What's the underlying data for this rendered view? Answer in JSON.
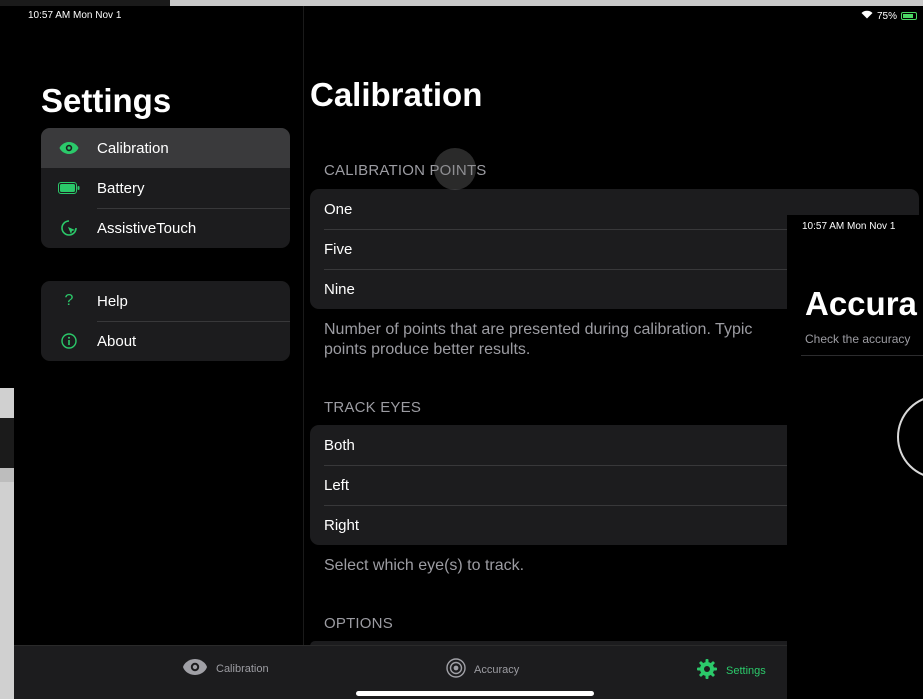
{
  "status": {
    "time": "10:57 AM  Mon Nov 1",
    "battery": "75%"
  },
  "sidebar": {
    "title": "Settings",
    "group1": [
      {
        "label": "Calibration",
        "icon": "eye-icon"
      },
      {
        "label": "Battery",
        "icon": "battery-icon"
      },
      {
        "label": "AssistiveTouch",
        "icon": "assistivetouch-icon"
      }
    ],
    "group2": [
      {
        "label": "Help",
        "icon": "question-icon"
      },
      {
        "label": "About",
        "icon": "info-icon"
      }
    ]
  },
  "main": {
    "title": "Calibration",
    "calibration_points": {
      "header": "CALIBRATION POINTS",
      "items": [
        "One",
        "Five",
        "Nine"
      ],
      "footer": "Number of points that are presented during calibration. Typic points produce better results."
    },
    "track_eyes": {
      "header": "TRACK EYES",
      "items": [
        "Both",
        "Left",
        "Right"
      ],
      "footer": "Select which eye(s) to track."
    },
    "options": {
      "header": "OPTIONS"
    }
  },
  "tabbar": {
    "tabs": [
      {
        "label": "Calibration",
        "icon": "eye-icon"
      },
      {
        "label": "Accuracy",
        "icon": "target-icon"
      },
      {
        "label": "Settings",
        "icon": "gear-icon"
      }
    ],
    "accent": "#2bc96a"
  },
  "slideover": {
    "status": "10:57 AM  Mon Nov 1",
    "title": "Accura",
    "subtitle": "Check the accuracy"
  }
}
